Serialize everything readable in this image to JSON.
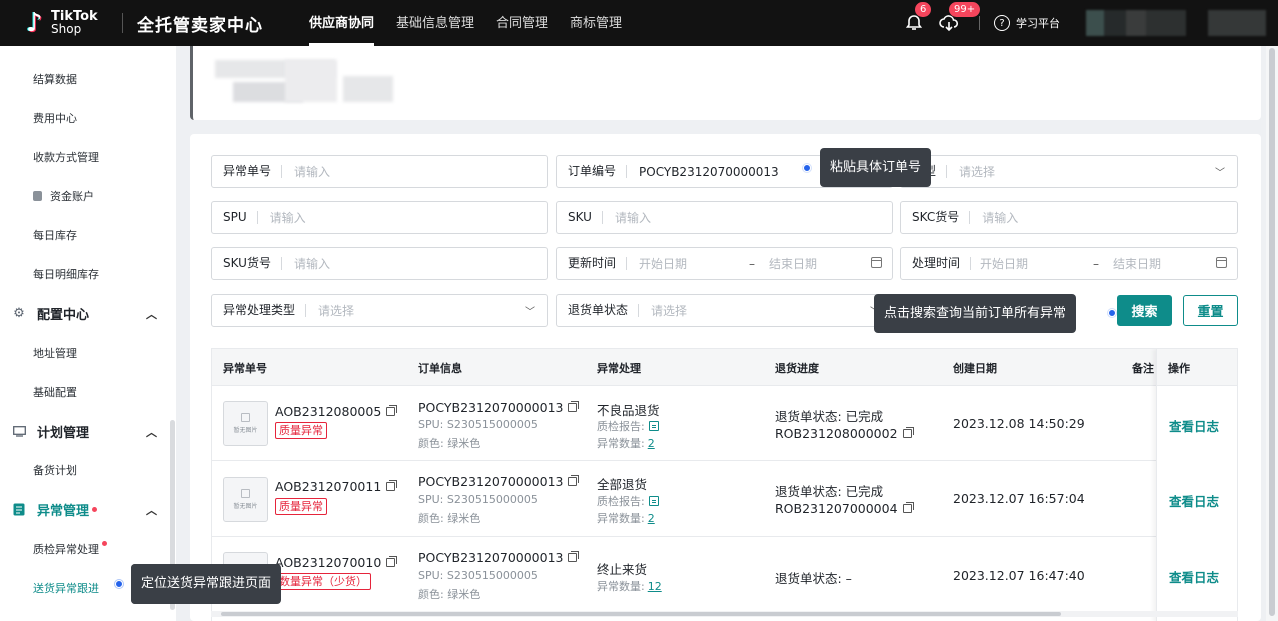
{
  "header": {
    "logo_line1": "TikTok",
    "logo_line2": "Shop",
    "app_title": "全托管卖家中心",
    "nav": [
      "供应商协同",
      "基础信息管理",
      "合同管理",
      "商标管理"
    ],
    "notification_badge": "6",
    "cloud_badge": "99+",
    "learn_label": "学习平台"
  },
  "sidebar": {
    "items_top": [
      "结算数据",
      "费用中心",
      "收款方式管理",
      "资金账户",
      "每日库存",
      "每日明细库存"
    ],
    "group_config": "配置中心",
    "config_items": [
      "地址管理",
      "基础配置"
    ],
    "group_plan": "计划管理",
    "plan_items": [
      "备货计划"
    ],
    "group_exception": "异常管理",
    "exception_items": [
      "质检异常处理",
      "送货异常跟进"
    ],
    "tooltip": "定位送货异常跟进页面"
  },
  "filters": {
    "exception_no_label": "异常单号",
    "exception_no_placeholder": "请输入",
    "order_no_label": "订单编号",
    "order_no_value": "POCYB2312070000013",
    "type_label": "类型",
    "type_placeholder": "请选择",
    "spu_label": "SPU",
    "spu_placeholder": "请输入",
    "sku_label": "SKU",
    "sku_placeholder": "请输入",
    "skc_label": "SKC货号",
    "skc_placeholder": "请输入",
    "sku_code_label": "SKU货号",
    "sku_code_placeholder": "请输入",
    "update_time_label": "更新时间",
    "start_placeholder": "开始日期",
    "end_placeholder": "结束日期",
    "dash": "–",
    "process_time_label": "处理时间",
    "handle_type_label": "异常处理类型",
    "handle_type_placeholder": "请选择",
    "return_status_label": "退货单状态",
    "return_status_placeholder": "请选择",
    "search_button": "搜索",
    "reset_button": "重置",
    "tooltip_order": "粘贴具体订单号",
    "tooltip_search": "点击搜索查询当前订单所有异常"
  },
  "table": {
    "headers": [
      "异常单号",
      "订单信息",
      "异常处理",
      "退货进度",
      "创建日期",
      "备注",
      "操作"
    ],
    "thumb_text": "暂无图片",
    "rows": [
      {
        "aob": "AOB2312080005",
        "tag": "质量异常",
        "order": "POCYB2312070000013",
        "spu": "SPU: S230515000005",
        "color": "颜色: 绿米色",
        "handling": "不良品退货",
        "report_label": "质检报告:",
        "qty_label": "异常数量:",
        "qty": "2",
        "return_status": "退货单状态: 已完成",
        "return_no": "ROB231208000002",
        "created": "2023.12.08 14:50:29",
        "op": "查看日志"
      },
      {
        "aob": "AOB2312070011",
        "tag": "质量异常",
        "order": "POCYB2312070000013",
        "spu": "SPU: S230515000005",
        "color": "颜色: 绿米色",
        "handling": "全部退货",
        "report_label": "质检报告:",
        "qty_label": "异常数量:",
        "qty": "2",
        "return_status": "退货单状态: 已完成",
        "return_no": "ROB231207000004",
        "created": "2023.12.07 16:57:04",
        "op": "查看日志"
      },
      {
        "aob": "AOB2312070010",
        "tag": "数量异常（少货）",
        "order": "POCYB2312070000013",
        "spu": "SPU: S230515000005",
        "color": "颜色: 绿米色",
        "handling": "终止来货",
        "qty_label": "异常数量:",
        "qty": "12",
        "return_status": "退货单状态: –",
        "created": "2023.12.07 16:47:40",
        "op": "查看日志"
      }
    ]
  },
  "colors": {
    "brand": "#0e8c8a",
    "danger": "#e5243b",
    "topbar": "#121212"
  }
}
